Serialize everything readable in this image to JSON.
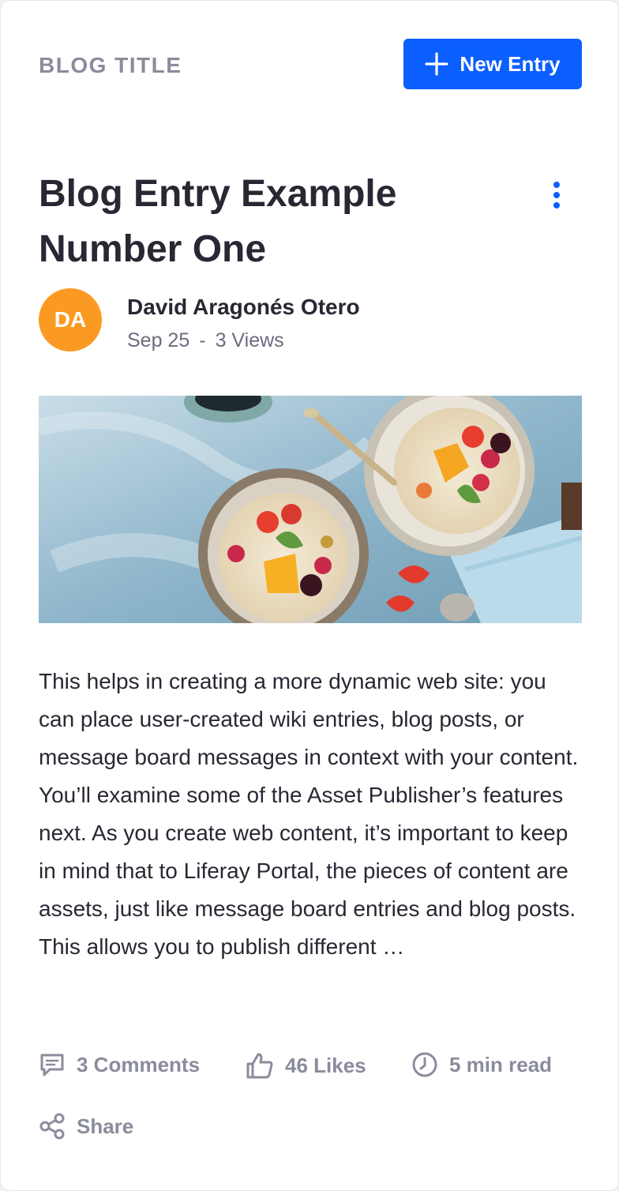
{
  "header": {
    "blog_title": "BLOG TITLE",
    "new_entry_label": "New Entry"
  },
  "entry": {
    "title": "Blog Entry Example Number One",
    "author_initials": "DA",
    "author_name": "David Aragonés Otero",
    "date": "Sep 25",
    "views": "3 Views",
    "body": "This helps in creating a more dynamic web site: you can place user-created wiki entries, blog posts, or message board messages in context with your content. You’ll examine some of the Asset Publisher’s features next. As you create web content, it’s important to keep in mind that to Liferay Portal, the pieces of content are assets, just like message board entries and blog posts. This allows you to publish different …"
  },
  "footer": {
    "comments": "3 Comments",
    "likes": "46 Likes",
    "read_time": "5 min read",
    "share": "Share"
  },
  "colors": {
    "accent": "#0b5fff",
    "avatar": "#fb9a22",
    "muted": "#8a8c9c"
  },
  "icons": [
    "plus-icon",
    "kebab-menu-icon",
    "comment-icon",
    "thumbs-up-icon",
    "clock-icon",
    "share-icon"
  ]
}
